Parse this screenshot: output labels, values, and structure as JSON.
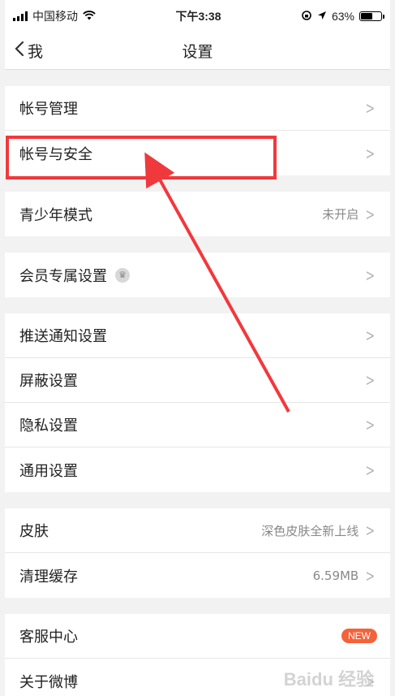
{
  "status_bar": {
    "carrier": "中国移动",
    "time": "下午3:38",
    "battery_percent": "63%",
    "battery_level": 0.63
  },
  "nav": {
    "back_label": "我",
    "title": "设置"
  },
  "groups": [
    {
      "items": [
        {
          "label": "帐号管理",
          "value": ""
        },
        {
          "label": "帐号与安全",
          "value": ""
        }
      ]
    },
    {
      "items": [
        {
          "label": "青少年模式",
          "value": "未开启"
        }
      ]
    },
    {
      "items": [
        {
          "label": "会员专属设置",
          "value": ""
        }
      ]
    },
    {
      "items": [
        {
          "label": "推送通知设置",
          "value": ""
        },
        {
          "label": "屏蔽设置",
          "value": ""
        },
        {
          "label": "隐私设置",
          "value": ""
        },
        {
          "label": "通用设置",
          "value": ""
        }
      ]
    },
    {
      "items": [
        {
          "label": "皮肤",
          "value": "深色皮肤全新上线"
        },
        {
          "label": "清理缓存",
          "value": "6.59MB"
        }
      ]
    },
    {
      "items": [
        {
          "label": "客服中心",
          "badge": "NEW"
        },
        {
          "label": "关于微博",
          "value": ""
        }
      ]
    }
  ],
  "annotation": {
    "highlight_color": "#f0393d"
  },
  "watermark": "Baidu 经验"
}
